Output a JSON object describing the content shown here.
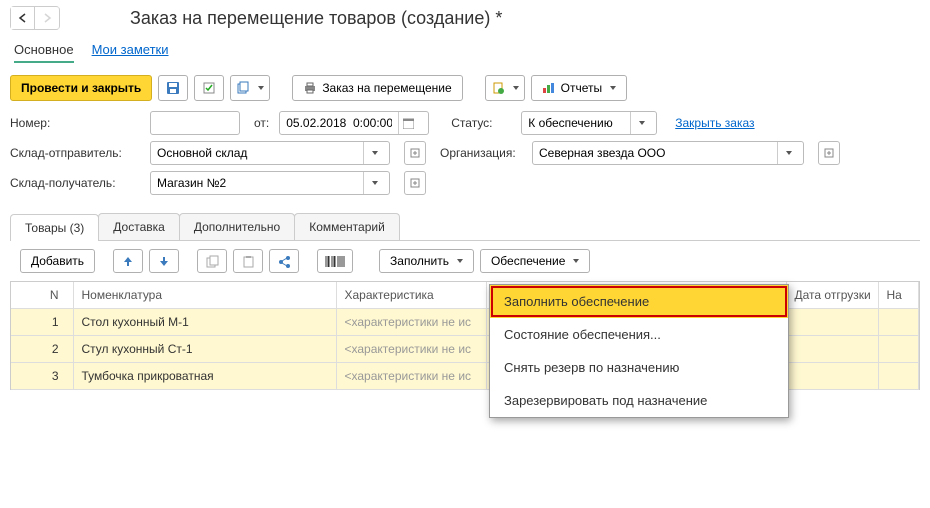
{
  "page_title": "Заказ на перемещение товаров (создание) *",
  "subtabs": {
    "main": "Основное",
    "notes": "Мои заметки"
  },
  "toolbar": {
    "submit_close": "Провести и закрыть",
    "print_order": "Заказ на перемещение",
    "reports": "Отчеты"
  },
  "form": {
    "number_label": "Номер:",
    "number_value": "",
    "from_label": "от:",
    "date_value": "05.02.2018  0:00:00",
    "status_label": "Статус:",
    "status_value": "К обеспечению",
    "close_order": "Закрыть заказ",
    "sender_label": "Склад-отправитель:",
    "sender_value": "Основной склад",
    "org_label": "Организация:",
    "org_value": "Северная звезда ООО",
    "receiver_label": "Склад-получатель:",
    "receiver_value": "Магазин №2"
  },
  "tabs": {
    "goods": "Товары (3)",
    "delivery": "Доставка",
    "extra": "Дополнительно",
    "comment": "Комментарий"
  },
  "grid_toolbar": {
    "add": "Добавить",
    "fill": "Заполнить",
    "supply": "Обеспечение"
  },
  "columns": {
    "n": "N",
    "item": "Номенклатура",
    "char": "Характеристика",
    "ship_date": "Дата отгрузки",
    "next": "На"
  },
  "rows": [
    {
      "n": "1",
      "item": "Стол кухонный М-1",
      "char": "<характеристики не ис"
    },
    {
      "n": "2",
      "item": "Стул кухонный Ст-1",
      "char": "<характеристики не ис"
    },
    {
      "n": "3",
      "item": "Тумбочка прикроватная",
      "char": "<характеристики не ис"
    }
  ],
  "supply_menu": {
    "fill": "Заполнить обеспечение",
    "state": "Состояние обеспечения...",
    "release": "Снять резерв по назначению",
    "reserve": "Зарезервировать под назначение"
  }
}
